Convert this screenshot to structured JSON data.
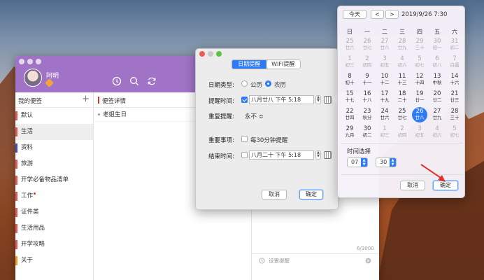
{
  "main_window": {
    "user_name": "阿明",
    "sidebar_title": "我的便签",
    "add_symbol": "+",
    "categories": [
      {
        "label": "默认",
        "color": "#e05a5a",
        "selected": false
      },
      {
        "label": "生活",
        "color": "#e05a5a",
        "selected": true
      },
      {
        "label": "资料",
        "color": "#3a4fc0",
        "selected": false
      },
      {
        "label": "旅游",
        "color": "#e05a5a",
        "selected": false
      },
      {
        "label": "开学必备物品清单",
        "color": "#e05a5a",
        "selected": false
      },
      {
        "label": "工作",
        "color": "#e05a5a",
        "selected": false
      },
      {
        "label": "证件类",
        "color": "#e05a5a",
        "selected": false
      },
      {
        "label": "生活用品",
        "color": "#e05a5a",
        "selected": false
      },
      {
        "label": "开学攻略",
        "color": "#e05a5a",
        "selected": false
      },
      {
        "label": "关于",
        "color": "#e8a030",
        "selected": false
      }
    ],
    "detail_title": "便签详情",
    "memo_items": [
      "老姐生日"
    ],
    "char_count": "6/3000",
    "set_reminder": "设置提醒"
  },
  "reminder_dialog": {
    "tabs": [
      "日期提醒",
      "WIFI提醒"
    ],
    "active_tab": 0,
    "date_type_label": "日期类型:",
    "date_type_options": [
      "公历",
      "农历"
    ],
    "date_type_selected": 1,
    "remind_time_label": "提醒时间:",
    "remind_time_value": "八月廿八 下午  5:18",
    "repeat_label": "重复提醒:",
    "repeat_value": "永不 ≎",
    "important_label": "重要事项:",
    "important_option": "每30分钟提醒",
    "end_time_label": "结束时间:",
    "end_time_value": "八月二十 下午  5:18",
    "cancel": "取消",
    "confirm": "确定"
  },
  "calendar": {
    "today_button": "今天",
    "prev": "<",
    "next": ">",
    "header": "2019/9/26 7:30",
    "weekdays": [
      "日",
      "一",
      "二",
      "三",
      "四",
      "五",
      "六"
    ],
    "rows": [
      [
        {
          "n": "25",
          "l": "廿六",
          "g": true
        },
        {
          "n": "26",
          "l": "廿七",
          "g": true
        },
        {
          "n": "27",
          "l": "廿八",
          "g": true
        },
        {
          "n": "28",
          "l": "廿九",
          "g": true
        },
        {
          "n": "29",
          "l": "三十",
          "g": true
        },
        {
          "n": "30",
          "l": "初一",
          "g": true
        },
        {
          "n": "31",
          "l": "初二",
          "g": true
        }
      ],
      [
        {
          "n": "1",
          "l": "初三",
          "g": true
        },
        {
          "n": "2",
          "l": "初四",
          "g": true
        },
        {
          "n": "3",
          "l": "初五",
          "g": true
        },
        {
          "n": "4",
          "l": "初六",
          "g": true
        },
        {
          "n": "5",
          "l": "初七",
          "g": true
        },
        {
          "n": "6",
          "l": "初八",
          "g": true
        },
        {
          "n": "7",
          "l": "白露",
          "g": true
        }
      ],
      [
        {
          "n": "8",
          "l": "初十"
        },
        {
          "n": "9",
          "l": "十一"
        },
        {
          "n": "10",
          "l": "十二"
        },
        {
          "n": "11",
          "l": "十三"
        },
        {
          "n": "12",
          "l": "十四"
        },
        {
          "n": "13",
          "l": "中秋"
        },
        {
          "n": "14",
          "l": "十六"
        }
      ],
      [
        {
          "n": "15",
          "l": "十七"
        },
        {
          "n": "16",
          "l": "十八"
        },
        {
          "n": "17",
          "l": "十九"
        },
        {
          "n": "18",
          "l": "二十"
        },
        {
          "n": "19",
          "l": "廿一"
        },
        {
          "n": "20",
          "l": "廿二"
        },
        {
          "n": "21",
          "l": "廿三"
        }
      ],
      [
        {
          "n": "22",
          "l": "廿四"
        },
        {
          "n": "23",
          "l": "秋分"
        },
        {
          "n": "24",
          "l": "廿六"
        },
        {
          "n": "25",
          "l": "廿七"
        },
        {
          "n": "26",
          "l": "廿八",
          "s": true
        },
        {
          "n": "27",
          "l": "廿九"
        },
        {
          "n": "28",
          "l": "三十"
        }
      ],
      [
        {
          "n": "29",
          "l": "九月"
        },
        {
          "n": "30",
          "l": "初二"
        },
        {
          "n": "1",
          "l": "初三",
          "g": true
        },
        {
          "n": "2",
          "l": "初四",
          "g": true
        },
        {
          "n": "3",
          "l": "初五",
          "g": true
        },
        {
          "n": "4",
          "l": "初六",
          "g": true
        },
        {
          "n": "5",
          "l": "初七",
          "g": true
        }
      ]
    ],
    "time_label": "时间选择",
    "hour": "07",
    "minute": "30",
    "cancel": "取消",
    "confirm": "确定"
  },
  "colors": {
    "accent": "#a173c7",
    "selected_blue": "#2f7bf5"
  }
}
